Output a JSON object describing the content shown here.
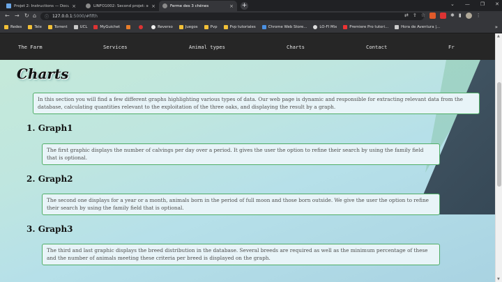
{
  "browser": {
    "tabs": [
      {
        "label": "Projet 2: Instructions — Docume",
        "fav_color": "#6aa6e6"
      },
      {
        "label": "LINFO1002: Second projet: sourc",
        "fav_color": "#8a8a8a"
      },
      {
        "label": "Ferme des 3 chênes",
        "fav_color": "#8a8a8a"
      }
    ],
    "new_tab": "+",
    "url_host": "127.0.0.1",
    "url_path": ":5000/#fifth",
    "bookmarks": [
      {
        "label": "Redes",
        "color": "#f2c037"
      },
      {
        "label": "Tele",
        "color": "#f2c037"
      },
      {
        "label": "Torrent",
        "color": "#f2c037"
      },
      {
        "label": "UCL",
        "color": "#c9c9c9"
      },
      {
        "label": "MyGuichet",
        "color": "#d33"
      },
      {
        "label": "",
        "color": "#e87d2a"
      },
      {
        "label": "",
        "color": "#d33"
      },
      {
        "label": "Reverso",
        "color": "#eee"
      },
      {
        "label": "Juegos",
        "color": "#f2c037"
      },
      {
        "label": "Pvp",
        "color": "#f2c037"
      },
      {
        "label": "Pvp tutoriales",
        "color": "#f2c037"
      },
      {
        "label": "Chrome Web Store...",
        "color": "#4a90e2"
      },
      {
        "label": "LO-FI Mix",
        "color": "#ddd"
      },
      {
        "label": "Premiere Pro tutori...",
        "color": "#e33"
      },
      {
        "label": "Hora de Aventura |...",
        "color": "#ccc"
      }
    ],
    "bookmarks_more": "»"
  },
  "nav": {
    "items": [
      "The Farm",
      "Services",
      "Animal types",
      "Charts",
      "Contact",
      "Fr"
    ]
  },
  "page": {
    "title": "Charts",
    "intro": "In this section you will find a few different graphs highlighting various types of data. Our web page is dynamic and responsible for extracting relevant data from the database, calculating quantities relevant to the exploitation of the three oaks, and displaying the result by a graph.",
    "sections": [
      {
        "heading": "1. Graph1",
        "text": "The first graphic displays the number of calvings per day over a period. It gives the user the option to refine their search by using the family field that is optional."
      },
      {
        "heading": "2. Graph2",
        "text": "The second one displays for a year or a month, animals born in the period of full moon and those born outside. We give the user the option to refine their search by using the family field that is optional."
      },
      {
        "heading": "3. Graph3",
        "text": "The third and last graphic displays the breed distribution in the database. Several breeds are required as well as the minimum percentage of these and the number of animals meeting these criteria per breed is displayed on the graph."
      }
    ]
  }
}
